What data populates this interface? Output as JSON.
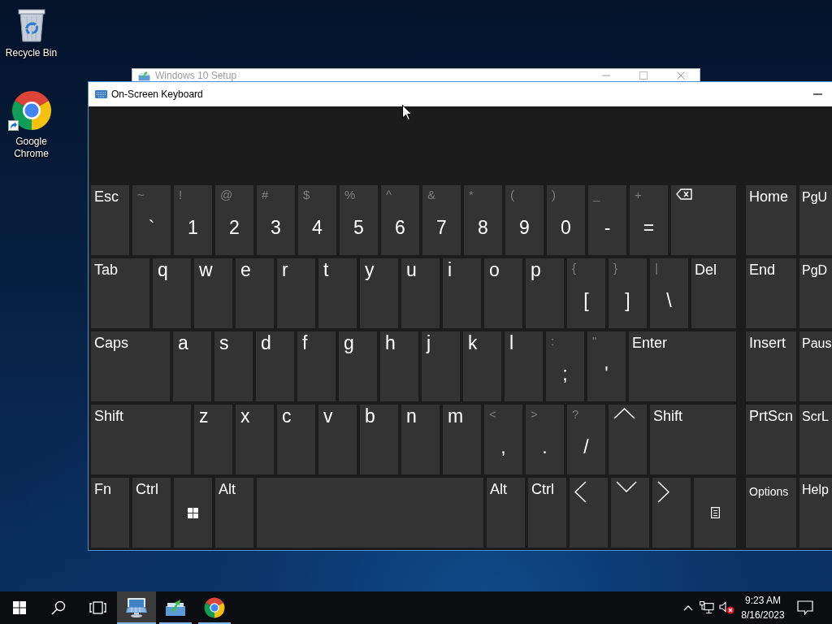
{
  "desktop": {
    "icons": [
      {
        "kind": "bin",
        "label": "Recycle Bin",
        "shortcut": false
      },
      {
        "kind": "browser",
        "label": "Google Chrome",
        "shortcut": true
      }
    ]
  },
  "background_window": {
    "title": "Windows 10 Setup"
  },
  "keyboard_window": {
    "title": "On-Screen Keyboard",
    "rows": [
      {
        "keys": [
          {
            "kind": "label",
            "label": "Esc"
          },
          {
            "kind": "dual",
            "shift": "~",
            "label": "`"
          },
          {
            "kind": "dual",
            "shift": "!",
            "label": "1"
          },
          {
            "kind": "dual",
            "shift": "@",
            "label": "2"
          },
          {
            "kind": "dual",
            "shift": "#",
            "label": "3"
          },
          {
            "kind": "dual",
            "shift": "$",
            "label": "4"
          },
          {
            "kind": "dual",
            "shift": "%",
            "label": "5"
          },
          {
            "kind": "dual",
            "shift": "^",
            "label": "6"
          },
          {
            "kind": "dual",
            "shift": "&",
            "label": "7"
          },
          {
            "kind": "dual",
            "shift": "*",
            "label": "8"
          },
          {
            "kind": "dual",
            "shift": "(",
            "label": "9"
          },
          {
            "kind": "dual",
            "shift": ")",
            "label": "0"
          },
          {
            "kind": "dual",
            "shift": "_",
            "label": "-"
          },
          {
            "kind": "dual",
            "shift": "+",
            "label": "="
          },
          {
            "kind": "backspace"
          }
        ]
      },
      {
        "keys": [
          {
            "kind": "label",
            "label": "Tab"
          },
          {
            "kind": "letter",
            "label": "q"
          },
          {
            "kind": "letter",
            "label": "w"
          },
          {
            "kind": "letter",
            "label": "e"
          },
          {
            "kind": "letter",
            "label": "r"
          },
          {
            "kind": "letter",
            "label": "t"
          },
          {
            "kind": "letter",
            "label": "y"
          },
          {
            "kind": "letter",
            "label": "u"
          },
          {
            "kind": "letter",
            "label": "i"
          },
          {
            "kind": "letter",
            "label": "o"
          },
          {
            "kind": "letter",
            "label": "p"
          },
          {
            "kind": "dual",
            "shift": "{",
            "label": "["
          },
          {
            "kind": "dual",
            "shift": "}",
            "label": "]"
          },
          {
            "kind": "dual",
            "shift": "|",
            "label": "\\"
          },
          {
            "kind": "label",
            "label": "Del"
          }
        ]
      },
      {
        "keys": [
          {
            "kind": "label",
            "label": "Caps"
          },
          {
            "kind": "letter",
            "label": "a"
          },
          {
            "kind": "letter",
            "label": "s"
          },
          {
            "kind": "letter",
            "label": "d"
          },
          {
            "kind": "letter",
            "label": "f"
          },
          {
            "kind": "letter",
            "label": "g"
          },
          {
            "kind": "letter",
            "label": "h"
          },
          {
            "kind": "letter",
            "label": "j"
          },
          {
            "kind": "letter",
            "label": "k"
          },
          {
            "kind": "letter",
            "label": "l"
          },
          {
            "kind": "dual",
            "shift": ":",
            "label": ";"
          },
          {
            "kind": "dual",
            "shift": "\"",
            "label": "'"
          },
          {
            "kind": "label",
            "label": "Enter"
          }
        ]
      },
      {
        "keys": [
          {
            "kind": "label",
            "label": "Shift"
          },
          {
            "kind": "letter",
            "label": "z"
          },
          {
            "kind": "letter",
            "label": "x"
          },
          {
            "kind": "letter",
            "label": "c"
          },
          {
            "kind": "letter",
            "label": "v"
          },
          {
            "kind": "letter",
            "label": "b"
          },
          {
            "kind": "letter",
            "label": "n"
          },
          {
            "kind": "letter",
            "label": "m"
          },
          {
            "kind": "dual",
            "shift": "<",
            "label": ","
          },
          {
            "kind": "dual",
            "shift": ">",
            "label": "."
          },
          {
            "kind": "dual",
            "shift": "?",
            "label": "/"
          },
          {
            "kind": "up"
          },
          {
            "kind": "label",
            "label": "Shift"
          }
        ]
      },
      {
        "keys": [
          {
            "kind": "label",
            "label": "Fn"
          },
          {
            "kind": "label",
            "label": "Ctrl"
          },
          {
            "kind": "winkey"
          },
          {
            "kind": "label",
            "label": "Alt"
          },
          {
            "kind": "space"
          },
          {
            "kind": "label",
            "label": "Alt"
          },
          {
            "kind": "label",
            "label": "Ctrl"
          },
          {
            "kind": "left"
          },
          {
            "kind": "down"
          },
          {
            "kind": "right"
          },
          {
            "kind": "menukey"
          }
        ]
      }
    ],
    "nav_rows": [
      {
        "keys": [
          {
            "kind": "label",
            "label": "Home"
          },
          {
            "kind": "label",
            "label": "PgU"
          }
        ]
      },
      {
        "keys": [
          {
            "kind": "label",
            "label": "End"
          },
          {
            "kind": "label",
            "label": "PgD"
          }
        ]
      },
      {
        "keys": [
          {
            "kind": "label",
            "label": "Insert"
          },
          {
            "kind": "label",
            "label": "Paus"
          }
        ]
      },
      {
        "keys": [
          {
            "kind": "label",
            "label": "PrtScn"
          },
          {
            "kind": "label",
            "label": "ScrL"
          }
        ]
      },
      {
        "keys": [
          {
            "kind": "small",
            "label": "Options"
          },
          {
            "kind": "label",
            "label": "Help"
          }
        ]
      }
    ]
  },
  "taskbar": {
    "apps": [
      {
        "kind": "keyboard",
        "selected": true
      },
      {
        "kind": "installer",
        "selected": false
      },
      {
        "kind": "browser",
        "selected": false
      }
    ],
    "tray": {
      "muted": true
    },
    "clock": {
      "time": "9:23 AM",
      "date": "8/16/2023"
    }
  }
}
